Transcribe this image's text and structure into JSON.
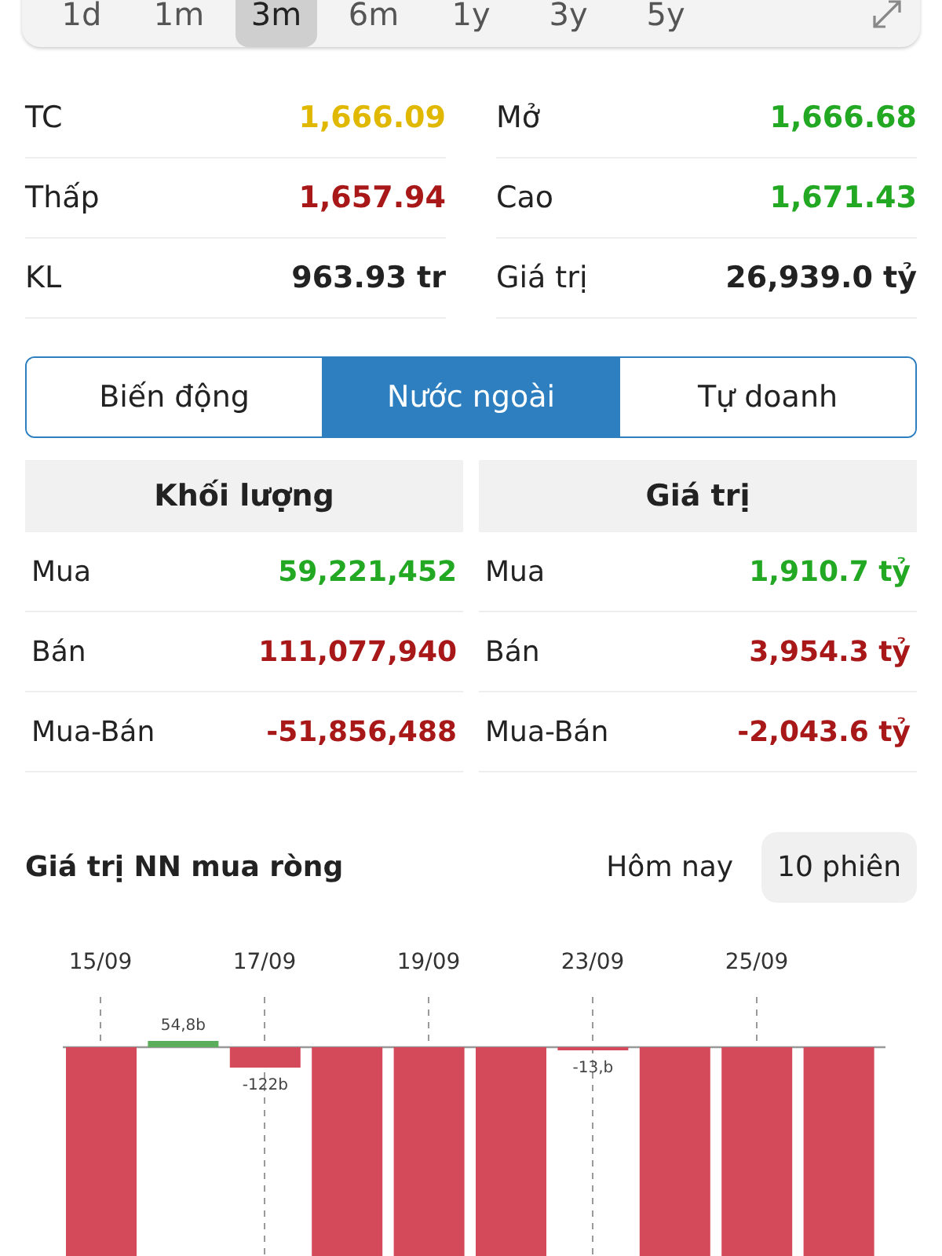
{
  "periods": [
    {
      "label": "1d",
      "selected": false
    },
    {
      "label": "1m",
      "selected": false
    },
    {
      "label": "3m",
      "selected": true
    },
    {
      "label": "6m",
      "selected": false
    },
    {
      "label": "1y",
      "selected": false
    },
    {
      "label": "3y",
      "selected": false
    },
    {
      "label": "5y",
      "selected": false
    }
  ],
  "stats": [
    {
      "label": "TC",
      "value": "1,666.09",
      "kind": "ref"
    },
    {
      "label": "Mở",
      "value": "1,666.68",
      "kind": "up"
    },
    {
      "label": "Thấp",
      "value": "1,657.94",
      "kind": "down"
    },
    {
      "label": "Cao",
      "value": "1,671.43",
      "kind": "up"
    },
    {
      "label": "KL",
      "value": "963.93 tr",
      "kind": "plain"
    },
    {
      "label": "Giá trị",
      "value": "26,939.0 tỷ",
      "kind": "plain"
    }
  ],
  "segments": [
    {
      "label": "Biến động",
      "selected": false
    },
    {
      "label": "Nước ngoài",
      "selected": true
    },
    {
      "label": "Tự doanh",
      "selected": false
    }
  ],
  "panels": [
    {
      "title": "Khối lượng",
      "rows": [
        {
          "label": "Mua",
          "value": "59,221,452",
          "kind": "up"
        },
        {
          "label": "Bán",
          "value": "111,077,940",
          "kind": "down"
        },
        {
          "label": "Mua-Bán",
          "value": "-51,856,488",
          "kind": "down"
        }
      ]
    },
    {
      "title": "Giá trị",
      "rows": [
        {
          "label": "Mua",
          "value": "1,910.7 tỷ",
          "kind": "up"
        },
        {
          "label": "Bán",
          "value": "3,954.3 tỷ",
          "kind": "down"
        },
        {
          "label": "Mua-Bán",
          "value": "-2,043.6 tỷ",
          "kind": "down"
        }
      ]
    }
  ],
  "net_chart": {
    "title": "Giá trị NN mua ròng",
    "ranges": [
      {
        "label": "Hôm nay",
        "selected": false
      },
      {
        "label": "10 phiên",
        "selected": true
      }
    ],
    "dates": [
      "15/09",
      "17/09",
      "19/09",
      "23/09",
      "25/09"
    ],
    "bars": [
      {
        "kind": "down"
      },
      {
        "kind": "up",
        "label": "54,8b"
      },
      {
        "kind": "down",
        "label": "-122b"
      },
      {
        "kind": "down"
      },
      {
        "kind": "down"
      },
      {
        "kind": "down"
      },
      {
        "kind": "down",
        "label": "-13,b"
      },
      {
        "kind": "down"
      },
      {
        "kind": "down"
      },
      {
        "kind": "down"
      }
    ]
  }
}
